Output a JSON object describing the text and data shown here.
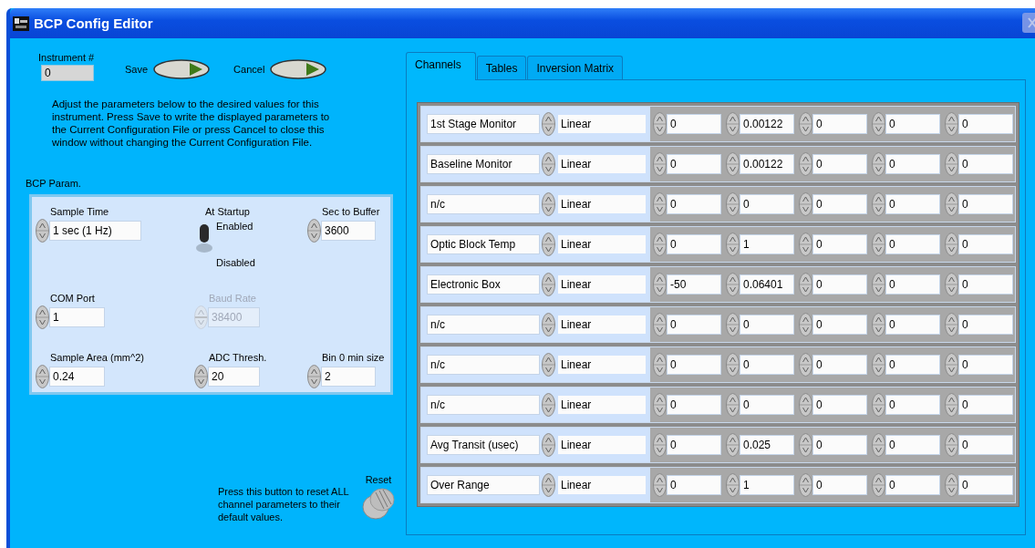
{
  "window": {
    "title": "BCP Config Editor"
  },
  "instrument": {
    "label": "Instrument #",
    "value": "0"
  },
  "buttons": [
    {
      "label": "Save"
    },
    {
      "label": "Cancel"
    }
  ],
  "instructions": "Adjust the parameters below to the desired values for this instrument.  Press Save to write the displayed parameters to the Current Configuration File or press Cancel to close this window without changing the Current Configuration File.",
  "bcp_param": {
    "title": "BCP Param.",
    "sample_time": {
      "label": "Sample Time",
      "value": "1 sec (1 Hz)",
      "disabled": false
    },
    "at_startup": {
      "label": "At Startup",
      "on_label": "Enabled",
      "off_label": "Disabled",
      "on": true
    },
    "sec_to_buffer": {
      "label": "Sec to Buffer",
      "value": "3600",
      "disabled": false
    },
    "com_port": {
      "label": "COM Port",
      "value": "1",
      "disabled": false
    },
    "baud_rate": {
      "label": "Baud Rate",
      "value": "38400",
      "disabled": true
    },
    "sample_area": {
      "label": "Sample Area (mm^2)",
      "value": "0.24",
      "disabled": false
    },
    "adc_thresh": {
      "label": "ADC Thresh.",
      "value": "20",
      "disabled": false
    },
    "bin0_min_size": {
      "label": "Bin 0 min size",
      "value": "2",
      "disabled": false
    }
  },
  "reset": {
    "label": "Reset",
    "note": "Press this button to reset ALL channel parameters to their default values."
  },
  "tabs": [
    {
      "label": "Channels",
      "selected": true
    },
    {
      "label": "Tables",
      "selected": false
    },
    {
      "label": "Inversion Matrix",
      "selected": false
    }
  ],
  "channels": [
    {
      "name": "1st Stage Monitor",
      "type": "Linear",
      "values": [
        "0",
        "0.00122",
        "0",
        "0",
        "0"
      ]
    },
    {
      "name": "Baseline Monitor",
      "type": "Linear",
      "values": [
        "0",
        "0.00122",
        "0",
        "0",
        "0"
      ]
    },
    {
      "name": "n/c",
      "type": "Linear",
      "values": [
        "0",
        "0",
        "0",
        "0",
        "0"
      ]
    },
    {
      "name": "Optic Block Temp",
      "type": "Linear",
      "values": [
        "0",
        "1",
        "0",
        "0",
        "0"
      ]
    },
    {
      "name": "Electronic Box",
      "type": "Linear",
      "values": [
        "-50",
        "0.06401",
        "0",
        "0",
        "0"
      ]
    },
    {
      "name": "n/c",
      "type": "Linear",
      "values": [
        "0",
        "0",
        "0",
        "0",
        "0"
      ]
    },
    {
      "name": "n/c",
      "type": "Linear",
      "values": [
        "0",
        "0",
        "0",
        "0",
        "0"
      ]
    },
    {
      "name": "n/c",
      "type": "Linear",
      "values": [
        "0",
        "0",
        "0",
        "0",
        "0"
      ]
    },
    {
      "name": "Avg Transit (usec)",
      "type": "Linear",
      "values": [
        "0",
        "0.025",
        "0",
        "0",
        "0"
      ]
    },
    {
      "name": "Over Range",
      "type": "Linear",
      "values": [
        "0",
        "1",
        "0",
        "0",
        "0"
      ]
    }
  ]
}
